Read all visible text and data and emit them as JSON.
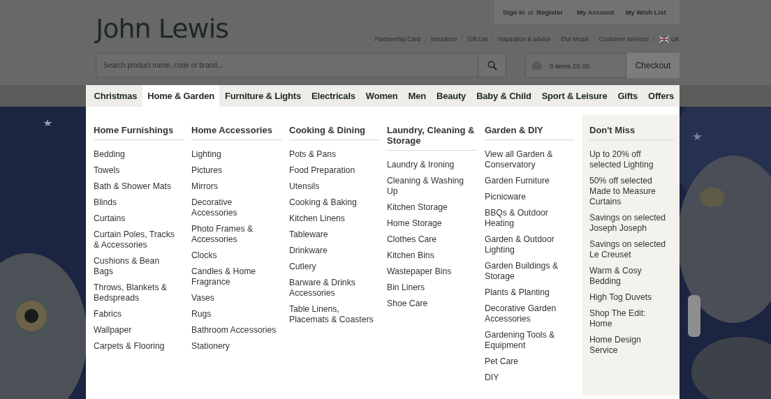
{
  "header": {
    "logo": "John Lewis",
    "account": {
      "sign_in": "Sign in",
      "separator": "or",
      "register": "Register",
      "links": [
        "My Account",
        "My Wish List"
      ]
    },
    "utility_links": [
      "Partnership Card",
      "Insurance",
      "Gift List",
      "Inspiration & advice",
      "Our shops",
      "Customer services"
    ],
    "region": "UK",
    "search": {
      "placeholder": "Search product name, code or brand..."
    },
    "basket": {
      "summary": "0 items £0.00",
      "checkout": "Checkout"
    }
  },
  "nav_tabs": [
    {
      "label": "Christmas",
      "selected": false
    },
    {
      "label": "Home & Garden",
      "selected": true
    },
    {
      "label": "Furniture & Lights",
      "selected": false
    },
    {
      "label": "Electricals",
      "selected": false
    },
    {
      "label": "Women",
      "selected": false
    },
    {
      "label": "Men",
      "selected": false
    },
    {
      "label": "Beauty",
      "selected": false
    },
    {
      "label": "Baby & Child",
      "selected": false
    },
    {
      "label": "Sport & Leisure",
      "selected": false
    },
    {
      "label": "Gifts",
      "selected": false
    },
    {
      "label": "Offers",
      "selected": false
    }
  ],
  "mega_menu": {
    "columns": [
      {
        "kind": "plain",
        "heading": "Home Furnishings",
        "items": [
          "Bedding",
          "Towels",
          "Bath & Shower Mats",
          "Blinds",
          "Curtains",
          "Curtain Poles, Tracks & Accessories",
          "Cushions & Bean Bags",
          "Throws, Blankets & Bedspreads",
          "Fabrics",
          "Wallpaper",
          "Carpets & Flooring"
        ]
      },
      {
        "kind": "plain",
        "heading": "Home Accessories",
        "items": [
          "Lighting",
          "Pictures",
          "Mirrors",
          "Decorative Accessories",
          "Photo Frames & Accessories",
          "Clocks",
          "Candles & Home Fragrance",
          "Vases",
          "Rugs",
          "Bathroom Accessories",
          "Stationery"
        ]
      },
      {
        "kind": "plain",
        "heading": "Cooking & Dining",
        "items": [
          "Pots & Pans",
          "Food Preparation",
          "Utensils",
          "Cooking & Baking",
          "Kitchen Linens",
          "Tableware",
          "Drinkware",
          "Cutlery",
          "Barware & Drinks Accessories",
          "Table Linens, Placemats & Coasters"
        ]
      },
      {
        "kind": "plain",
        "heading": "Laundry, Cleaning & Storage",
        "items": [
          "Laundry & Ironing",
          "Cleaning & Washing Up",
          "Kitchen Storage",
          "Home Storage",
          "Clothes Care",
          "Kitchen Bins",
          "Wastepaper Bins",
          "Bin Liners",
          "Shoe Care"
        ]
      },
      {
        "kind": "plain",
        "heading": "Garden & DIY",
        "items": [
          "View all Garden & Conservatory",
          "Garden Furniture",
          "Picnicware",
          "BBQs & Outdoor Heating",
          "Garden & Outdoor Lighting",
          "Garden Buildings & Storage",
          "Plants & Planting",
          "Decorative Garden Accessories",
          "Gardening Tools & Equipment",
          "Pet Care",
          "DIY"
        ]
      },
      {
        "kind": "promo",
        "heading": "Don't Miss",
        "items": [
          "Up to 20% off selected Lighting",
          "50% off selected Made to Measure Curtains",
          "Savings on selected Joseph Joseph",
          "Savings on selected Le Creuset",
          "Warm & Cosy Bedding",
          "High Tog Duvets",
          "Shop The Edit: Home",
          "Home Design Service"
        ]
      }
    ]
  }
}
